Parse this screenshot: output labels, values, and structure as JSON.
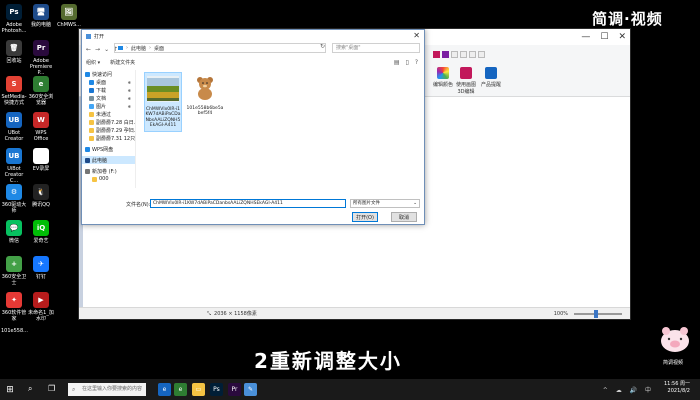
{
  "watermark": "简调·视频",
  "desktop": {
    "icons": [
      {
        "label": "Adobe Photosh...",
        "glyph": "Ps",
        "color": "#001e36",
        "col": 1,
        "row": 0
      },
      {
        "label": "回收站",
        "glyph": "🗑",
        "color": "#3a3a3a",
        "col": 1,
        "row": 1
      },
      {
        "label": "SetMedia-快捷方式",
        "glyph": "S",
        "color": "#e34234",
        "col": 1,
        "row": 2
      },
      {
        "label": "UBot Creator",
        "glyph": "UB",
        "color": "#1565c0",
        "col": 1,
        "row": 3
      },
      {
        "label": "UiBot Creator C...",
        "glyph": "UB",
        "color": "#1976d2",
        "col": 1,
        "row": 4
      },
      {
        "label": "360驱动大师",
        "glyph": "⚙",
        "color": "#1e88e5",
        "col": 1,
        "row": 5
      },
      {
        "label": "微信",
        "glyph": "💬",
        "color": "#07c160",
        "col": 1,
        "row": 6
      },
      {
        "label": "360安全卫士",
        "glyph": "+",
        "color": "#43a047",
        "col": 1,
        "row": 7
      },
      {
        "label": "360软件管家",
        "glyph": "✦",
        "color": "#e53935",
        "col": 1,
        "row": 8
      },
      {
        "label": "我的电脑",
        "glyph": "🖥",
        "color": "#1e4b8a",
        "col": 2,
        "row": 0
      },
      {
        "label": "Adobe Premiere P...",
        "glyph": "Pr",
        "color": "#2a0a3d",
        "col": 2,
        "row": 1
      },
      {
        "label": "360安全浏览器",
        "glyph": "e",
        "color": "#2e7d32",
        "col": 2,
        "row": 2
      },
      {
        "label": "WPS Office",
        "glyph": "W",
        "color": "#c62828",
        "col": 2,
        "row": 3
      },
      {
        "label": "EV录屏",
        "glyph": "❁",
        "color": "#ffffff",
        "col": 2,
        "row": 4
      },
      {
        "label": "腾讯QQ",
        "glyph": "🐧",
        "color": "#222222",
        "col": 2,
        "row": 5
      },
      {
        "label": "爱奇艺",
        "glyph": "iQ",
        "color": "#00be06",
        "col": 2,
        "row": 6
      },
      {
        "label": "钉钉",
        "glyph": "✈",
        "color": "#1677ff",
        "col": 2,
        "row": 7
      },
      {
        "label": "未命名1_加水印",
        "glyph": "▶",
        "color": "#b71c1c",
        "col": 2,
        "row": 8
      },
      {
        "label": "ChMWS...",
        "glyph": "🖼",
        "color": "#556b2f",
        "col": 3,
        "row": 0
      }
    ],
    "extra": {
      "label": "101e558...",
      "glyph": "🐻",
      "color": "#8d6e63"
    }
  },
  "paint": {
    "ribbon_groups": [
      {
        "label": "使用画图3D编辑",
        "color": "#c2185b"
      },
      {
        "label": "产品提醒",
        "color": "#1565c0"
      }
    ],
    "status": {
      "dimensions": "2036 × 1158像素",
      "zoom": "100%"
    }
  },
  "dialog": {
    "title": "打开",
    "close_glyph": "✕",
    "address": {
      "parts": [
        "此电脑",
        "桌面"
      ]
    },
    "search_placeholder": "搜索\"桌面\"",
    "toolbar": {
      "organize": "组织 ▾",
      "new_folder": "新建文件夹"
    },
    "nav": [
      {
        "label": "快速访问",
        "level": 0,
        "color": "#1e88e5",
        "pin": false
      },
      {
        "label": "桌面",
        "level": 1,
        "color": "#1e88e5",
        "pin": true
      },
      {
        "label": "下载",
        "level": 1,
        "color": "#1976d2",
        "pin": true
      },
      {
        "label": "文档",
        "level": 1,
        "color": "#78909c",
        "pin": true
      },
      {
        "label": "图片",
        "level": 1,
        "color": "#42a5f5",
        "pin": true
      },
      {
        "label": "未通过",
        "level": 1,
        "color": "#f6c343",
        "pin": false
      },
      {
        "label": "副爵爵7.28 白日…",
        "level": 1,
        "color": "#f6c343",
        "pin": false
      },
      {
        "label": "副爵爵7.29 孕妇…",
        "level": 1,
        "color": "#f6c343",
        "pin": false
      },
      {
        "label": "副爵爵7.31 12只…",
        "level": 1,
        "color": "#f6c343",
        "pin": false
      },
      {
        "label": "WPS网盘",
        "level": 0,
        "color": "#1e88e5",
        "pin": false
      },
      {
        "label": "此电脑",
        "level": 0,
        "color": "#1e4b8a",
        "pin": false,
        "selected": true
      },
      {
        "label": "新加卷 (F:)",
        "level": 0,
        "color": "#757575",
        "pin": false
      },
      {
        "label": "000",
        "level": 2,
        "color": "#f6c343",
        "pin": false
      }
    ],
    "files": [
      {
        "name": "ChMWVlx0lR-i1KW7dABiPaCDa NbsAALiZQNH5 EkAGI-A411",
        "kind": "landscape",
        "selected": true
      },
      {
        "name": "101e558b6be5a bef5f4",
        "kind": "bear",
        "selected": false
      }
    ],
    "filename_label": "文件名(N):",
    "filename_value": "ChMWVlx0lR-i1KW7dABiPaCDanbsAALiZQNHSEkAGI-A411",
    "filetype": "所有图片文件",
    "open_label": "打开(O)",
    "cancel_label": "取消"
  },
  "subtitle": "2重新调整大小",
  "sticker_label": "简调视频",
  "taskbar": {
    "search_placeholder": "在这里输入你要搜索的内容",
    "clock_time": "11:56 周一",
    "clock_date": "2021/8/2",
    "tray": "^ ☁ 🔊 中"
  }
}
